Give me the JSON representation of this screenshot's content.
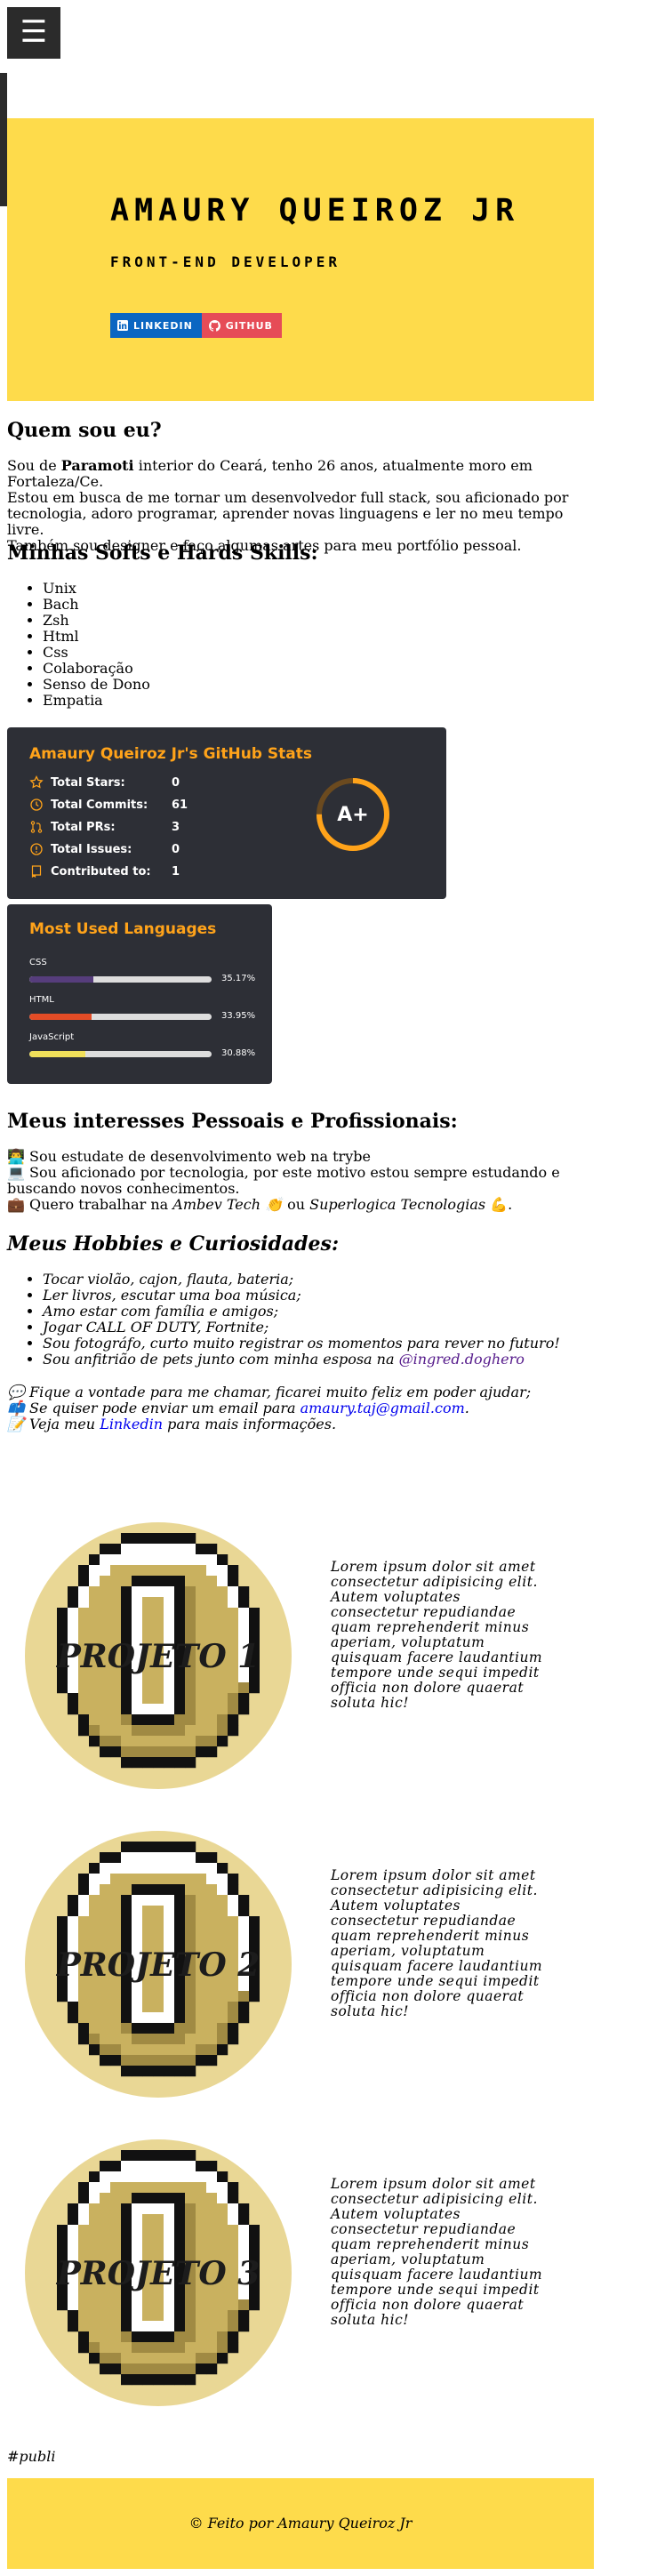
{
  "header": {
    "menu_icon": "hamburger-icon",
    "menu_glyph": "☰"
  },
  "hero": {
    "title": "AMAURY QUEIROZ JR",
    "subtitle": "FRONT-END DEVELOPER",
    "linkedin_label": "LINKEDIN",
    "github_label": "GITHUB",
    "bg_color": "#fedb4b"
  },
  "about": {
    "heading": "Quem sou eu?",
    "line1_pre": "Sou de ",
    "line1_bold": "Paramoti",
    "line1_post": " interior do Ceará, tenho 26 anos, atualmente moro em Fortaleza/Ce.",
    "line2": "Estou em busca de me tornar um desenvolvedor full stack, sou aficionado por tecnologia, adoro programar, aprender novas linguagens e ler no meu tempo livre.",
    "line3": "Também sou designer e faço algumas artes para meu portfólio pessoal."
  },
  "skills": {
    "heading": "Minhas Softs e Hards Skills:",
    "items": [
      "Unix",
      "Bach",
      "Zsh",
      "Html",
      "Css",
      "Colaboração",
      "Senso de Dono",
      "Empatia"
    ]
  },
  "github_stats": {
    "title": "Amaury Queiroz Jr's GitHub Stats",
    "rows": [
      {
        "label": "Total Stars:",
        "value": "0",
        "icon": "star-icon"
      },
      {
        "label": "Total Commits:",
        "value": "61",
        "icon": "history-icon"
      },
      {
        "label": "Total PRs:",
        "value": "3",
        "icon": "pull-request-icon"
      },
      {
        "label": "Total Issues:",
        "value": "0",
        "icon": "issue-icon"
      },
      {
        "label": "Contributed to:",
        "value": "1",
        "icon": "repo-icon"
      }
    ],
    "grade": "A+",
    "grade_progress": 0.75,
    "accent": "#ffa31a"
  },
  "languages": {
    "title": "Most Used Languages",
    "items": [
      {
        "name": "CSS",
        "percent": "35.17%",
        "fraction": 0.3517,
        "color": "#563d7c"
      },
      {
        "name": "HTML",
        "percent": "33.95%",
        "fraction": 0.3395,
        "color": "#e34c26"
      },
      {
        "name": "JavaScript",
        "percent": "30.88%",
        "fraction": 0.3088,
        "color": "#f1e05a"
      }
    ]
  },
  "interests": {
    "heading": "Meus interesses Pessoais e Profissionais:",
    "line1": "👨‍💻 Sou estudate de desenvolvimento web na trybe",
    "line2": "💻 Sou aficionado por tecnologia, por este motivo estou sempre estudando e buscando novos conhecimentos.",
    "line3_pre": "💼 Quero trabalhar na ",
    "line3_em1": "Ambev Tech 👏",
    "line3_mid": " ou ",
    "line3_em2": "Superlogica Tecnologias",
    "line3_post": " 💪."
  },
  "hobbies": {
    "heading": "Meus Hobbies e Curiosidades:",
    "items": [
      "Tocar violão, cajon, flauta, bateria;",
      "Ler livros, escutar uma boa música;",
      "Amo estar com família e amigos;",
      "Jogar CALL OF DUTY, Fortnite;",
      "Sou fotográfo, curto muito registrar os momentos para rever no futuro!"
    ],
    "last_pre": "Sou anfitrião de pets junto com minha esposa na ",
    "last_link": "@ingred.doghero"
  },
  "contact": {
    "line1": "💬 Fique a vontade para me chamar, ficarei muito feliz em poder ajudar;",
    "line2_pre": "📫 Se quiser pode enviar um email para ",
    "line2_link": "amaury.taj@gmail.com",
    "line2_post": ".",
    "line3_pre": "📝 Veja meu ",
    "line3_link": "Linkedin",
    "line3_post": " para mais informações."
  },
  "projects": [
    {
      "label": "PROJETO 1",
      "text": "Lorem ipsum dolor sit amet consectetur adipisicing elit. Autem voluptates consectetur repudiandae quam reprehenderit minus aperiam, voluptatum quisquam facere laudantium tempore unde sequi impedit officia non dolore quaerat soluta hic!"
    },
    {
      "label": "PROJETO 2",
      "text": "Lorem ipsum dolor sit amet consectetur adipisicing elit. Autem voluptates consectetur repudiandae quam reprehenderit minus aperiam, voluptatum quisquam facere laudantium tempore unde sequi impedit officia non dolore quaerat soluta hic!"
    },
    {
      "label": "PROJETO 3",
      "text": "Lorem ipsum dolor sit amet consectetur adipisicing elit. Autem voluptates consectetur repudiandae quam reprehenderit minus aperiam, voluptatum quisquam facere laudantium tempore unde sequi impedit officia non dolore quaerat soluta hic!"
    }
  ],
  "publi": "#publi",
  "footer": {
    "text": "© Feito por Amaury Queiroz Jr"
  }
}
